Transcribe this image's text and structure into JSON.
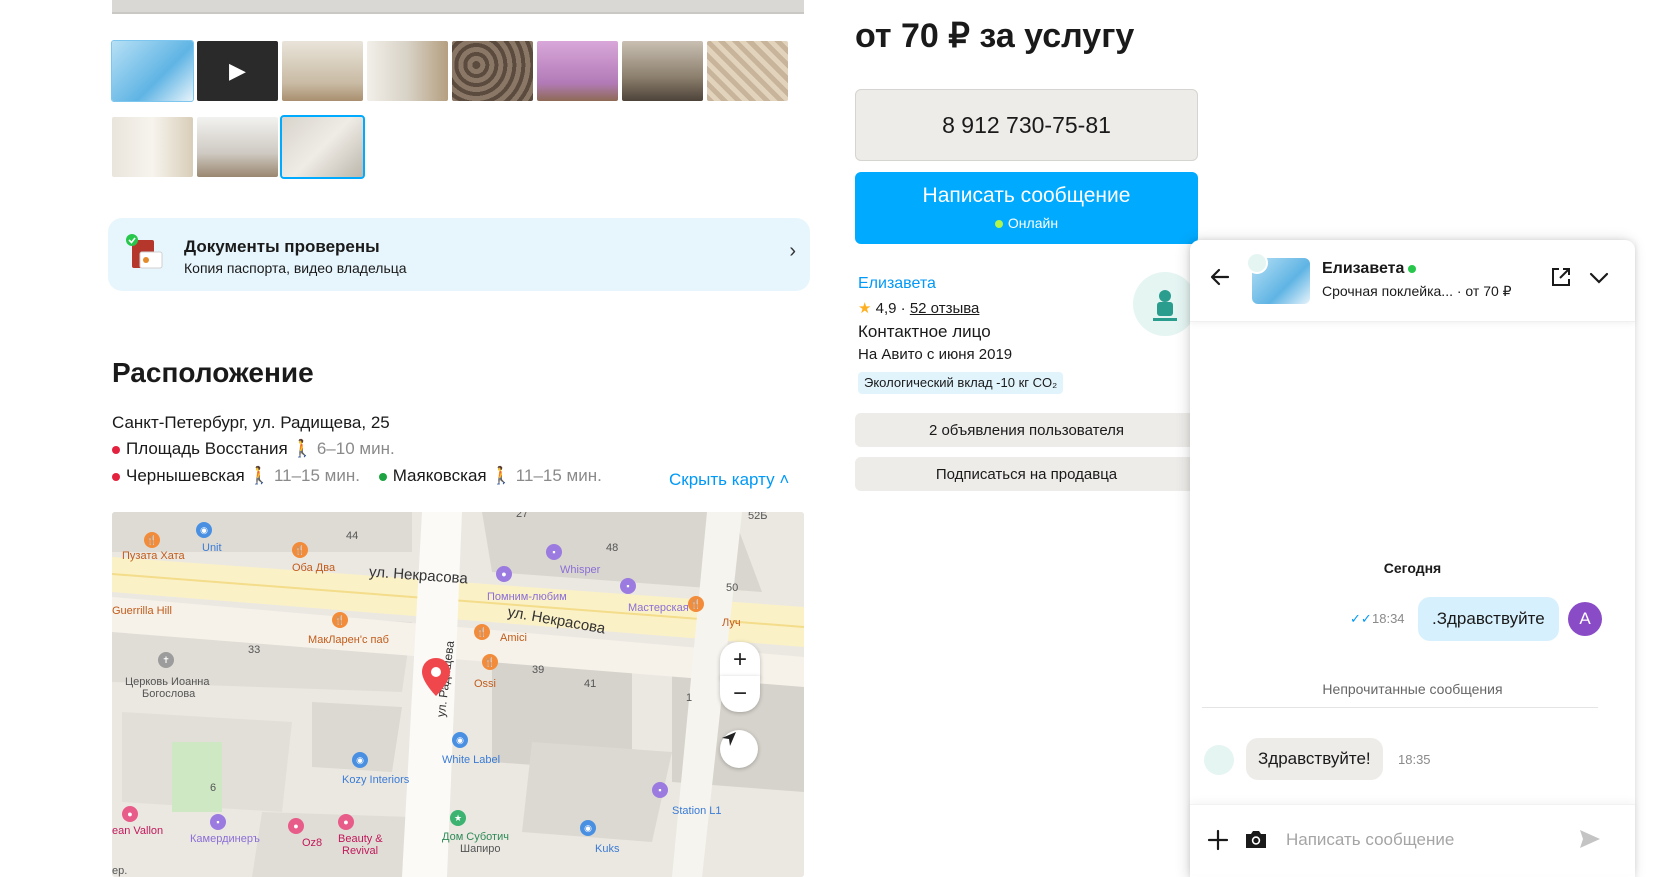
{
  "listing": {
    "price": "от 70 ₽ за услугу",
    "phone": "8 912 730-75-81",
    "write_button": "Написать сообщение",
    "write_status": "Онлайн"
  },
  "gallery": {
    "thumbnails": [
      "thumb-1",
      "thumb-video",
      "thumb-3",
      "thumb-4",
      "thumb-5",
      "thumb-6",
      "thumb-7",
      "thumb-8",
      "thumb-9",
      "thumb-10",
      "thumb-11"
    ],
    "active_index": 10
  },
  "docs": {
    "title": "Документы проверены",
    "subtitle": "Копия паспорта, видео владельца"
  },
  "location": {
    "title": "Расположение",
    "address": "Санкт-Петербург, ул. Радищева, 25",
    "metro": [
      {
        "name": "Площадь Восстания",
        "time": "6–10 мин.",
        "color": "#e4223f"
      },
      {
        "name": "Чернышевская",
        "time": "11–15 мин.",
        "color": "#e4223f"
      },
      {
        "name": "Маяковская",
        "time": "11–15 мин.",
        "color": "#1ea342"
      }
    ],
    "hide_map": "Скрыть карту"
  },
  "map": {
    "streets": [
      "ул. Некрасова",
      "ул. Некрасова",
      "ул. Радищева"
    ],
    "places": [
      "Пузата Хата",
      "Unit",
      "Оба Два",
      "Whisper",
      "Помним-любим",
      "Мастерская",
      "Луч",
      "Guerrilla Hill",
      "МакЛарен'с паб",
      "Amici",
      "Ossi",
      "Церковь Иоанна",
      "Богослова",
      "White Label",
      "Kozy Interiors",
      "Station L1",
      "Дом Суботич",
      "Шапиро",
      "Kuks",
      "Камердинеръ",
      "Oz8",
      "Beauty &",
      "Revival",
      "ean Vallon",
      "ер."
    ],
    "house_numbers": [
      "44",
      "27",
      "48",
      "52Б",
      "50",
      "33",
      "39",
      "41",
      "1",
      "6"
    ]
  },
  "seller": {
    "name": "Елизавета",
    "rating": "4,9",
    "reviews": "52 отзыва",
    "type": "Контактное лицо",
    "since": "На Авито с июня 2019",
    "eco": "Экологический вклад -10 кг CO₂",
    "ads_button": "2 объявления пользователя",
    "subscribe_button": "Подписаться на продавца"
  },
  "chat": {
    "name": "Елизавета",
    "listing": "Срочная поклейка...",
    "listing_price": "· от 70 ₽",
    "day": "Сегодня",
    "outgoing": {
      "text": ".Здравствуйте",
      "time": "18:34",
      "avatar_letter": "А"
    },
    "unread_label": "Непрочитанные сообщения",
    "incoming": {
      "text": "Здравствуйте!",
      "time": "18:35"
    },
    "input_placeholder": "Написать сообщение"
  },
  "colors": {
    "accent": "#00aaff",
    "link": "#0099f7",
    "online": "#26c74b"
  }
}
